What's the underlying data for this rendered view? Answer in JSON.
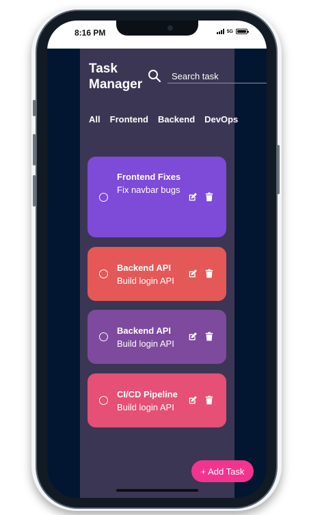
{
  "status_bar": {
    "time": "8:16 PM",
    "network": "5G"
  },
  "app": {
    "title": "Task Manager"
  },
  "search": {
    "placeholder": "Search task"
  },
  "filters": [
    "All",
    "Frontend",
    "Backend",
    "DevOps"
  ],
  "tasks": [
    {
      "title": "Frontend Fixes",
      "description": "Fix navbar bugs",
      "color": "#7e4ad8"
    },
    {
      "title": "Backend API",
      "description": "Build login API",
      "color": "#e55858"
    },
    {
      "title": "Backend API",
      "description": "Build login API",
      "color": "#7e4a9e"
    },
    {
      "title": "CI/CD Pipeline",
      "description": "Build login API",
      "color": "#e64f76"
    }
  ],
  "add_task": {
    "label": "+ Add Task"
  },
  "colors": {
    "page_bg": "#031631",
    "panel_bg": "#3b3653",
    "accent": "#f2348f"
  }
}
